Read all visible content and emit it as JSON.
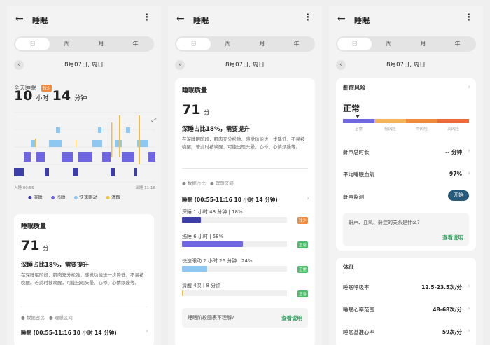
{
  "header": {
    "title": "睡眠"
  },
  "tabs": [
    "日",
    "周",
    "月",
    "年"
  ],
  "date": "8月07日, 周日",
  "allday": {
    "label": "全天睡眠",
    "badge": "较少",
    "hours": "10",
    "hour_unit": "小时",
    "minutes": "14",
    "minute_unit": "分钟"
  },
  "chart": {
    "start_label": "入睡 00:55",
    "end_label": "出睡 11:16",
    "legend": [
      {
        "name": "深睡",
        "color": "#3d3fa6"
      },
      {
        "name": "浅睡",
        "color": "#6f67e0"
      },
      {
        "name": "快速眼动",
        "color": "#8ec8f0"
      },
      {
        "name": "清醒",
        "color": "#f0c040"
      }
    ]
  },
  "quality": {
    "title": "睡眠质量",
    "score": "71",
    "score_unit": "分",
    "summary": "深睡占比18%，需要提升",
    "desc": "在深睡眠阶段，肌肉充分松弛、感觉功能进一步降低，不易被唤醒。若此时被唤醒，可能出现头晕、心悸、心情烦躁等。",
    "legend_data": "数据占比",
    "legend_ideal": "理想区间"
  },
  "record": {
    "title": "睡眠 (00:55-11:16 10 小时 14 分钟)",
    "stages": [
      {
        "label": "深睡  1 小时 48 分钟 | 18%",
        "badge": "较少",
        "badge_color": "#f08a3c",
        "pct": 18,
        "color": "#3d3fa6"
      },
      {
        "label": "浅睡  6 小时 | 58%",
        "badge": "正常",
        "badge_color": "#4cbb6a",
        "pct": 58,
        "color": "#6f67e0"
      },
      {
        "label": "快速眼动  2 小时 26 分钟 | 24%",
        "badge": "正常",
        "badge_color": "#4cbb6a",
        "pct": 24,
        "color": "#8ec8f0"
      },
      {
        "label": "清醒  4次 | 8 分钟",
        "badge": "正常",
        "badge_color": "#4cbb6a",
        "pct": 1,
        "color": "#f0c040"
      }
    ]
  },
  "help": {
    "question": "睡眠阶段图表不理解?",
    "link": "查看说明"
  },
  "snore": {
    "title": "鼾症风险",
    "status": "正常",
    "levels": [
      {
        "label": "正常",
        "color": "#6f67e0"
      },
      {
        "label": "低风险",
        "color": "#f5b35a"
      },
      {
        "label": "中风险",
        "color": "#f08a3c"
      },
      {
        "label": "高风险",
        "color": "#ee6a3b"
      }
    ],
    "total_label": "鼾声总时长",
    "total_value": "-- 分钟",
    "spo2_label": "平均睡眠血氧",
    "spo2_value": "97%",
    "monitor_label": "鼾声监测",
    "monitor_button": "开始",
    "faq": "鼾声、血氧、鼾症的关系是什么?",
    "faq_link": "查看说明"
  },
  "vitals": {
    "title": "体征",
    "rows": [
      {
        "label": "睡眠呼吸率",
        "value": "12.5-23.5次/分"
      },
      {
        "label": "睡眠心率范围",
        "value": "48-68次/分"
      },
      {
        "label": "睡眠基准心率",
        "value": "59次/分"
      }
    ]
  }
}
